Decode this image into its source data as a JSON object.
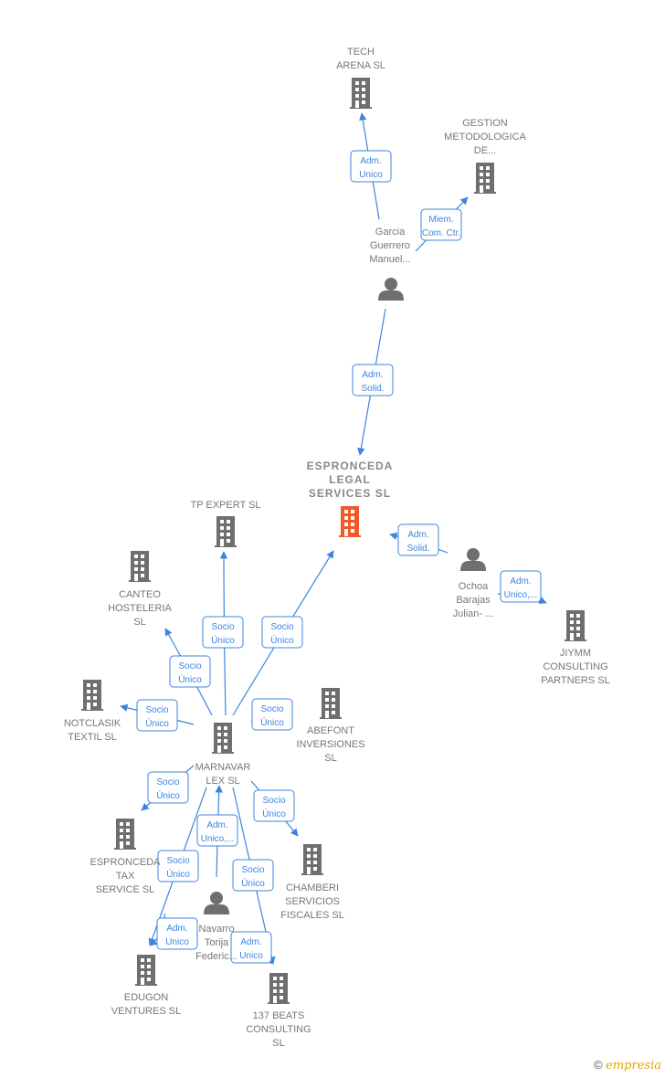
{
  "colors": {
    "accent": "#3d84e0",
    "node": "#6f6f6f",
    "highlight": "#f05a28"
  },
  "nodes": [
    {
      "id": "tech",
      "type": "company",
      "label": [
        "TECH",
        "ARENA SL"
      ]
    },
    {
      "id": "gestion",
      "type": "company",
      "label": [
        "GESTION",
        "METODOLOGICA",
        "DE..."
      ]
    },
    {
      "id": "garcia",
      "type": "person",
      "label": [
        "Garcia",
        "Guerrero",
        "Manuel..."
      ]
    },
    {
      "id": "legal",
      "type": "company",
      "main": true,
      "label": [
        "ESPRONCEDA",
        "LEGAL",
        "SERVICES  SL"
      ]
    },
    {
      "id": "tp",
      "type": "company",
      "label": [
        "TP EXPERT  SL"
      ]
    },
    {
      "id": "canteo",
      "type": "company",
      "label": [
        "CANTEO",
        "HOSTELERIA",
        "SL"
      ]
    },
    {
      "id": "notclasik",
      "type": "company",
      "label": [
        "NOTCLASIK",
        "TEXTIL  SL"
      ]
    },
    {
      "id": "marnavar",
      "type": "company",
      "label": [
        "MARNAVAR",
        "LEX  SL"
      ]
    },
    {
      "id": "abefont",
      "type": "company",
      "label": [
        "ABEFONT",
        "INVERSIONES",
        "SL"
      ]
    },
    {
      "id": "ochoa",
      "type": "person",
      "label": [
        "Ochoa",
        "Barajas",
        "Julian- ..."
      ]
    },
    {
      "id": "jiymm",
      "type": "company",
      "label": [
        "JIYMM",
        "CONSULTING",
        "PARTNERS  SL"
      ]
    },
    {
      "id": "tax",
      "type": "company",
      "label": [
        "ESPRONCEDA",
        "TAX",
        "SERVICE  SL"
      ]
    },
    {
      "id": "chamberi",
      "type": "company",
      "label": [
        "CHAMBERI",
        "SERVICIOS",
        "FISCALES  SL"
      ]
    },
    {
      "id": "navarro",
      "type": "person",
      "label": [
        "Navarro",
        "Torija",
        "Federic..."
      ]
    },
    {
      "id": "edugon",
      "type": "company",
      "label": [
        "EDUGON",
        "VENTURES  SL"
      ]
    },
    {
      "id": "beats",
      "type": "company",
      "label": [
        "137 BEATS",
        "CONSULTING",
        "SL"
      ]
    }
  ],
  "edges": [
    {
      "from": "garcia",
      "to": "tech",
      "label": [
        "Adm.",
        "Unico"
      ]
    },
    {
      "from": "garcia",
      "to": "gestion",
      "label": [
        "Miem.",
        "Com. Ctr."
      ]
    },
    {
      "from": "garcia",
      "to": "legal",
      "label": [
        "Adm.",
        "Solid."
      ]
    },
    {
      "from": "ochoa",
      "to": "legal",
      "label": [
        "Adm.",
        "Solid."
      ]
    },
    {
      "from": "ochoa",
      "to": "jiymm",
      "label": [
        "Adm.",
        "Unico,..."
      ]
    },
    {
      "from": "marnavar",
      "to": "tp",
      "label": [
        "Socio",
        "Único"
      ]
    },
    {
      "from": "marnavar",
      "to": "legal",
      "label": [
        "Socio",
        "Único"
      ]
    },
    {
      "from": "marnavar",
      "to": "canteo",
      "label": [
        "Socio",
        "Único"
      ]
    },
    {
      "from": "marnavar",
      "to": "notclasik",
      "label": [
        "Socio",
        "Único"
      ]
    },
    {
      "from": "marnavar",
      "to": "abefont",
      "label": [
        "Socio",
        "Único"
      ]
    },
    {
      "from": "marnavar",
      "to": "tax",
      "label": [
        "Socio",
        "Único"
      ]
    },
    {
      "from": "marnavar",
      "to": "chamberi",
      "label": [
        "Socio",
        "Único"
      ]
    },
    {
      "from": "marnavar",
      "to": "edugon",
      "label": [
        "Socio",
        "Único"
      ]
    },
    {
      "from": "marnavar",
      "to": "beats",
      "label": [
        "Socio",
        "Único"
      ]
    },
    {
      "from": "navarro",
      "to": "marnavar",
      "label": [
        "Adm.",
        "Unico,..."
      ]
    },
    {
      "from": "navarro",
      "to": "edugon",
      "label": [
        "Adm.",
        "Unico"
      ]
    },
    {
      "from": "navarro",
      "to": "beats",
      "label": [
        "Adm.",
        "Unico"
      ]
    }
  ],
  "footer": {
    "copyright": "©",
    "brand": "empresia"
  }
}
